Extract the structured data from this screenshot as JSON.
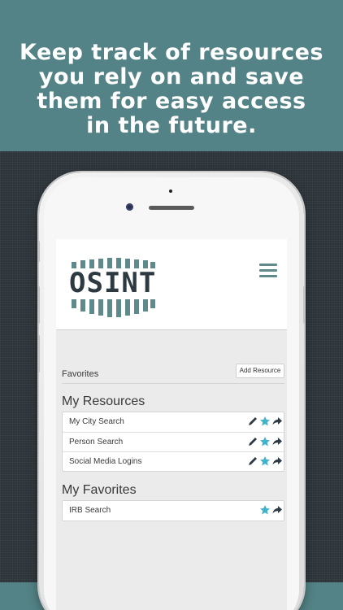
{
  "headline": {
    "line1": "Keep track of resources",
    "line2": "you rely on and save",
    "line3": "them for easy access",
    "line4": "in the future."
  },
  "colors": {
    "teal": "#538386",
    "dark_bg": "#2c343a",
    "accent_star": "#3fb3c9",
    "logo": "#2e3a42"
  },
  "app": {
    "logo_text": "OSINT",
    "menu_icon": "hamburger-menu-icon",
    "favorites_label": "Favorites",
    "add_resource_label": "Add Resource",
    "my_resources": {
      "title": "My Resources",
      "items": [
        {
          "label": "My City Search",
          "icons": [
            "pencil-icon",
            "star-icon",
            "share-arrow-icon"
          ]
        },
        {
          "label": "Person Search",
          "icons": [
            "pencil-icon",
            "star-icon",
            "share-arrow-icon"
          ]
        },
        {
          "label": "Social Media Logins",
          "icons": [
            "pencil-icon",
            "star-icon",
            "share-arrow-icon"
          ]
        }
      ]
    },
    "my_favorites": {
      "title": "My Favorites",
      "items": [
        {
          "label": "IRB Search",
          "icons": [
            "star-icon",
            "share-arrow-icon"
          ]
        }
      ]
    }
  }
}
